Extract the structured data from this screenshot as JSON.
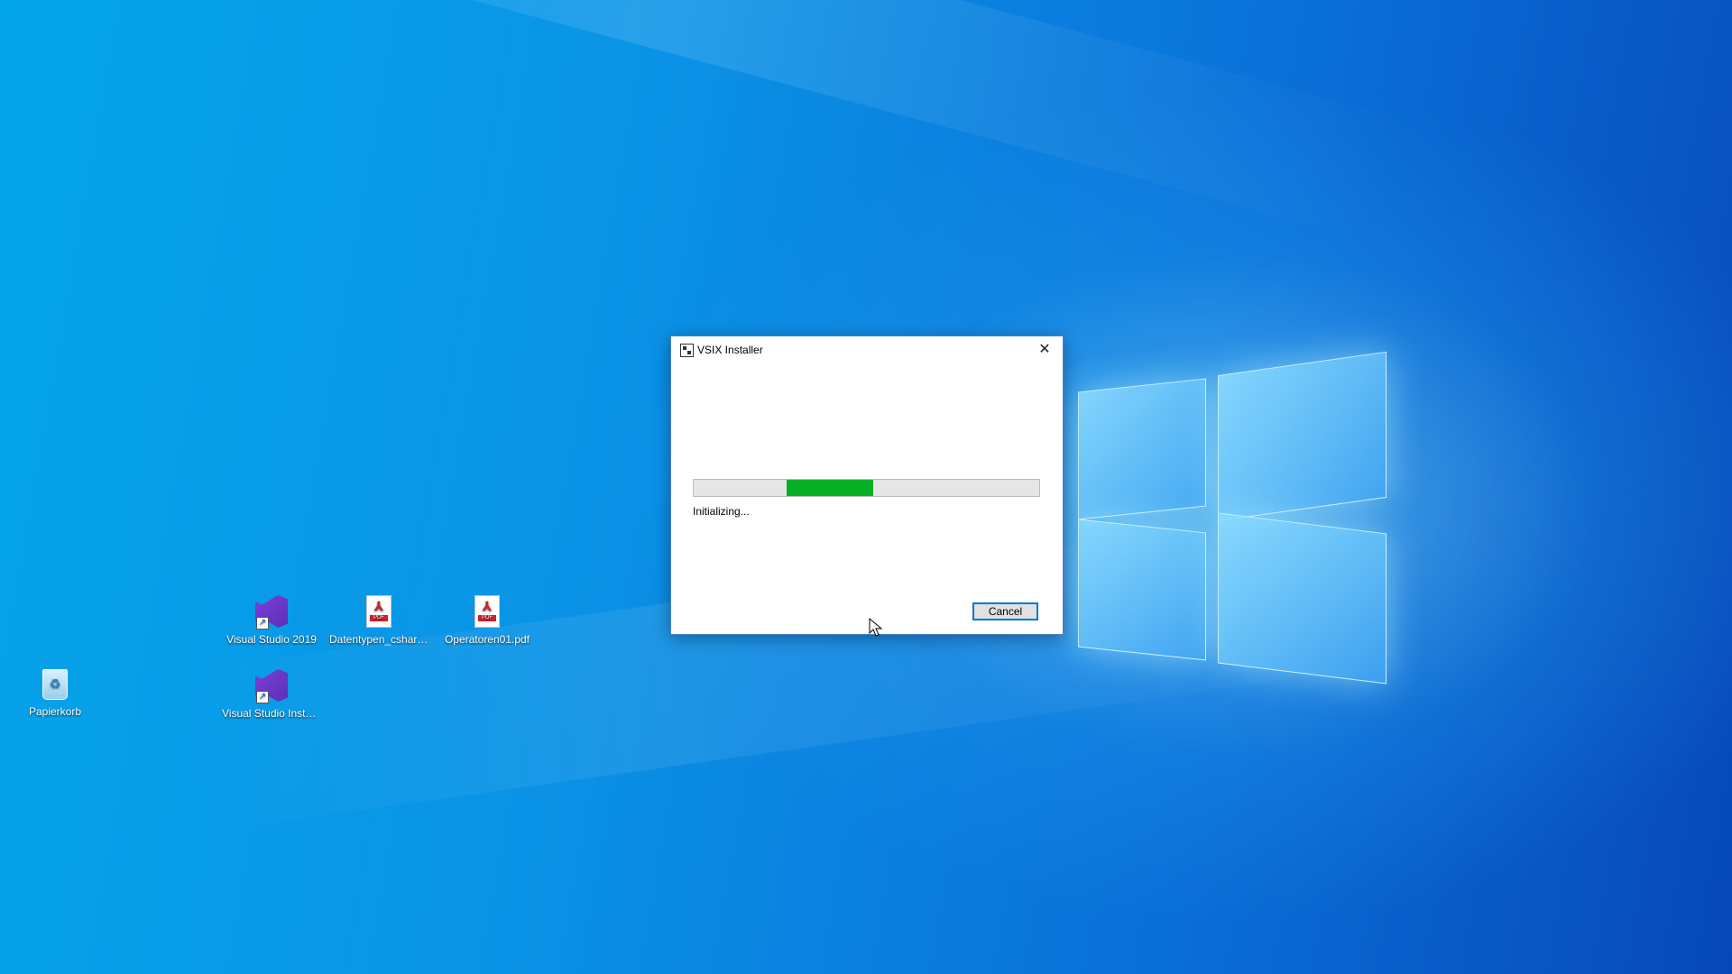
{
  "desktop": {
    "icons": [
      {
        "label": "Visual Studio 2019",
        "icon": "visual-studio-icon"
      },
      {
        "label": "Datentypen_csharp...",
        "icon": "pdf-file-icon"
      },
      {
        "label": "Operatoren01.pdf",
        "icon": "pdf-file-icon"
      },
      {
        "label": "Papierkorb",
        "icon": "recycle-bin-icon"
      },
      {
        "label": "Visual Studio Installer",
        "icon": "visual-studio-installer-icon"
      }
    ]
  },
  "dialog": {
    "title": "VSIX Installer",
    "close_symbol": "✕",
    "status": "Initializing...",
    "cancel_label": "Cancel",
    "progress_mode": "indeterminate",
    "progress_segment": [
      0.27,
      0.52
    ]
  },
  "colors": {
    "progress": "#06b025",
    "accent": "#0078d7",
    "desktop": "#0a93e6"
  }
}
